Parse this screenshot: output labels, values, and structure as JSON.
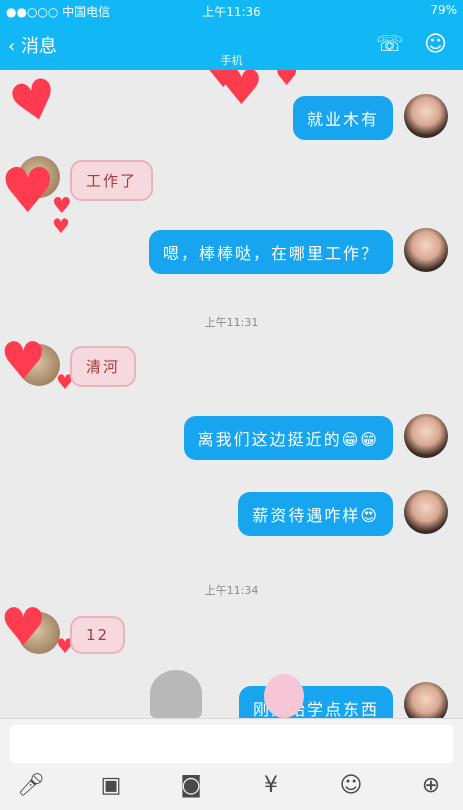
{
  "status_bar": {
    "carrier": "●●○○○ 中国电信",
    "time": "上午11:36",
    "battery": "79%"
  },
  "nav": {
    "back_label": "消息",
    "title": "",
    "subtitle": "手机"
  },
  "messages": [
    {
      "side": "right",
      "text": "就业木有"
    },
    {
      "side": "left",
      "text": "工作了"
    },
    {
      "side": "right",
      "text": "嗯，棒棒哒，在哪里工作？"
    },
    {
      "side": "time",
      "text": "上午11:31"
    },
    {
      "side": "left",
      "text": "清河"
    },
    {
      "side": "right",
      "text": "离我们这边挺近的😁😁"
    },
    {
      "side": "right",
      "text": "薪资待遇咋样😍"
    },
    {
      "side": "time",
      "text": "上午11:34"
    },
    {
      "side": "left",
      "text": "12"
    },
    {
      "side": "right",
      "text": "刚开始学点东西"
    }
  ],
  "toolbar": {
    "icons": [
      "microphone-icon",
      "image-icon",
      "camera-icon",
      "red-packet-icon",
      "emoji-icon",
      "plus-icon"
    ]
  },
  "colors": {
    "accent": "#12b7f5",
    "bubble_right": "#16a5ee",
    "bubble_left": "#f6d9de"
  }
}
